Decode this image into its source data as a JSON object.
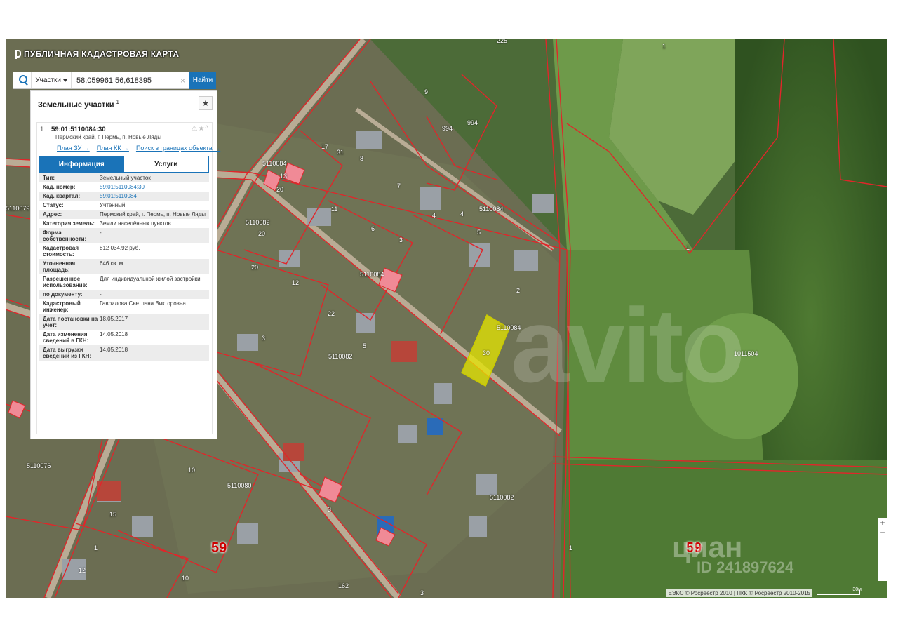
{
  "app": {
    "title": "ПУБЛИЧНАЯ КАДАСТРОВАЯ КАРТА"
  },
  "search": {
    "type_label": "Участки",
    "value": "58,059961 56,618395",
    "button": "Найти",
    "clear": "×"
  },
  "panel": {
    "heading": "Земельные участки",
    "count": "1",
    "star": "★",
    "item": {
      "index": "1.",
      "id": "59:01:5110084:30",
      "address": "Пермский край, г. Пермь, п. Новые Ляды",
      "icons": "⚠★^",
      "links": [
        "План ЗУ →",
        "План КК →",
        "Поиск в границах объекта →"
      ]
    },
    "tabs": [
      "Информация",
      "Услуги"
    ],
    "rows": [
      {
        "label": "Тип:",
        "value": "Земельный участок"
      },
      {
        "label": "Кад. номер:",
        "value": "59:01:5110084:30",
        "link": true
      },
      {
        "label": "Кад. квартал:",
        "value": "59:01:5110084",
        "link": true
      },
      {
        "label": "Статус:",
        "value": "Учтенный"
      },
      {
        "label": "Адрес:",
        "value": "Пермский край, г. Пермь, п. Новые Ляды"
      },
      {
        "label": "Категория земель:",
        "value": "Земли населённых пунктов"
      },
      {
        "label": "Форма собственности:",
        "value": "-"
      },
      {
        "label": "Кадастровая стоимость:",
        "value": "812 034,92 руб."
      },
      {
        "label": "Уточненная площадь:",
        "value": "646 кв. м"
      },
      {
        "label": "Разрешенное использование:",
        "value": "Для индивидуальной жилой застройки"
      },
      {
        "label": "по документу:",
        "value": "-"
      },
      {
        "label": "Кадастровый инженер:",
        "value": "Гаврилова Светлана Викторовна"
      },
      {
        "label": "Дата постановки на учет:",
        "value": "18.05.2017"
      },
      {
        "label": "Дата изменения сведений в ГКН:",
        "value": "14.05.2018"
      },
      {
        "label": "Дата выгрузки сведений из ГКН:",
        "value": "14.05.2018"
      }
    ]
  },
  "map": {
    "selected_label": "30",
    "quarters": [
      "5110084",
      "5110082",
      "5110079",
      "5110076",
      "5110080",
      "1011504"
    ],
    "region_labels": [
      "59",
      "59"
    ],
    "plot_numbers": [
      "1",
      "9",
      "994",
      "994",
      "17",
      "31",
      "8",
      "7",
      "13",
      "20",
      "11",
      "4",
      "4",
      "5",
      "6",
      "3",
      "12",
      "22",
      "5",
      "2",
      "10",
      "15",
      "3",
      "12",
      "1",
      "1",
      "1",
      "3",
      "162",
      "3",
      "10",
      "20",
      "20",
      "225"
    ],
    "attribution": "ЕЭКО © Росреестр 2010 | ПКК © Росреестр 2010-2015",
    "scale_label": "30м"
  },
  "watermarks": {
    "avito": "avito",
    "cian": "циан",
    "id": "ID 241897624"
  },
  "colors": {
    "accent": "#1a73b8",
    "boundary": "#e0262a",
    "selected": "#e6e600"
  }
}
